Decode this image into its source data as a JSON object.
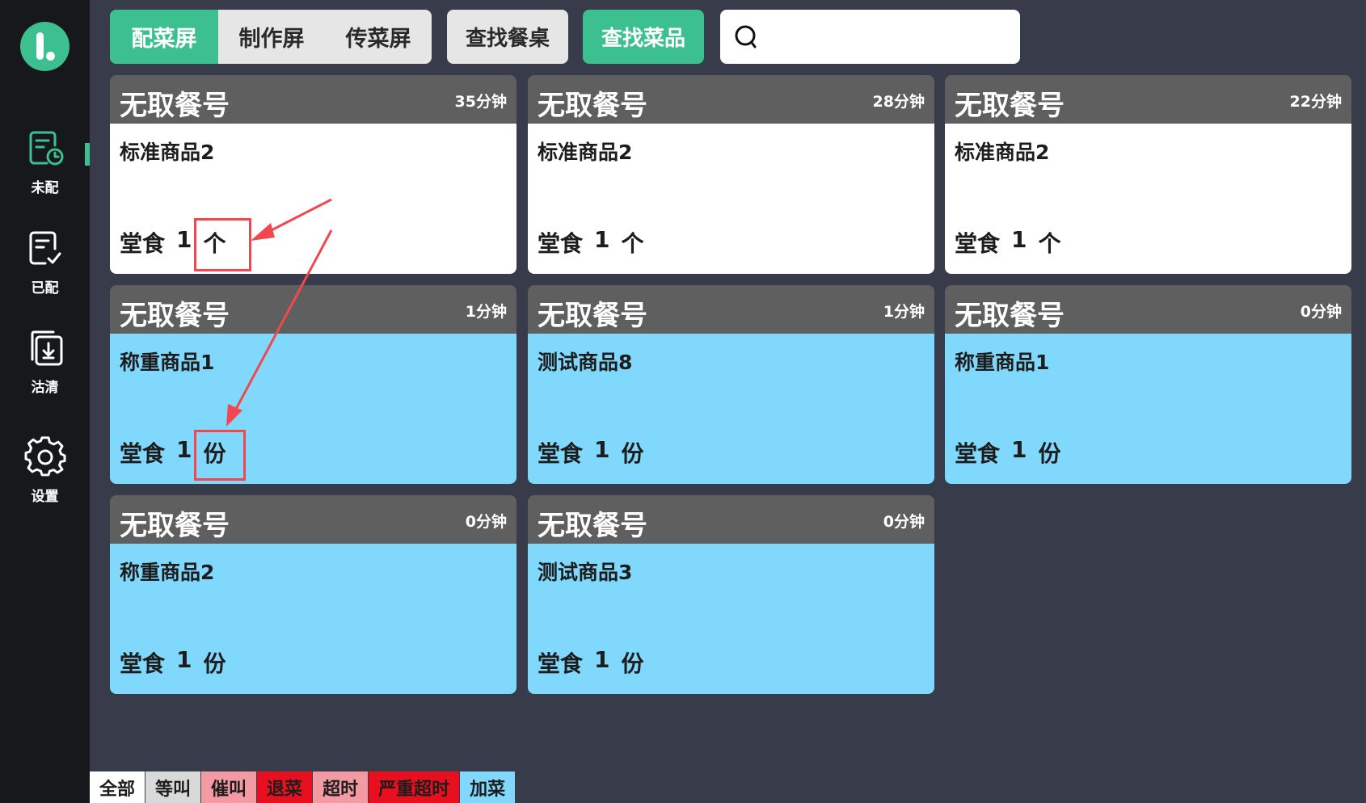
{
  "sidebar": {
    "logo": "app-logo",
    "items": [
      {
        "label": "未配",
        "icon": "pending-order-icon",
        "active": true
      },
      {
        "label": "已配",
        "icon": "done-order-icon",
        "active": false
      },
      {
        "label": "沽清",
        "icon": "sold-out-icon",
        "active": false
      },
      {
        "label": "设置",
        "icon": "gear-icon",
        "active": false
      }
    ]
  },
  "topbar": {
    "screens": [
      "配菜屏",
      "制作屏",
      "传菜屏"
    ],
    "active_screen": "配菜屏",
    "find_table": "查找餐桌",
    "find_dish": "查找菜品",
    "search": {
      "value": "",
      "placeholder": ""
    }
  },
  "cards": [
    {
      "order": "无取餐号",
      "time": "35分钟",
      "item": "标准商品2",
      "dine": "堂食",
      "count": "1",
      "unit": "个",
      "color": "#ffffff"
    },
    {
      "order": "无取餐号",
      "time": "28分钟",
      "item": "标准商品2",
      "dine": "堂食",
      "count": "1",
      "unit": "个",
      "color": "#ffffff"
    },
    {
      "order": "无取餐号",
      "time": "22分钟",
      "item": "标准商品2",
      "dine": "堂食",
      "count": "1",
      "unit": "个",
      "color": "#ffffff"
    },
    {
      "order": "无取餐号",
      "time": "1分钟",
      "item": "称重商品1",
      "dine": "堂食",
      "count": "1",
      "unit": "份",
      "color": "#80d8fc"
    },
    {
      "order": "无取餐号",
      "time": "1分钟",
      "item": "测试商品8",
      "dine": "堂食",
      "count": "1",
      "unit": "份",
      "color": "#80d8fc"
    },
    {
      "order": "无取餐号",
      "time": "0分钟",
      "item": "称重商品1",
      "dine": "堂食",
      "count": "1",
      "unit": "份",
      "color": "#80d8fc"
    },
    {
      "order": "无取餐号",
      "time": "0分钟",
      "item": "称重商品2",
      "dine": "堂食",
      "count": "1",
      "unit": "份",
      "color": "#80d8fc"
    },
    {
      "order": "无取餐号",
      "time": "0分钟",
      "item": "测试商品3",
      "dine": "堂食",
      "count": "1",
      "unit": "份",
      "color": "#80d8fc"
    }
  ],
  "legend": [
    {
      "label": "全部",
      "color": "#ffffff"
    },
    {
      "label": "等叫",
      "color": "#d9d9d9"
    },
    {
      "label": "催叫",
      "color": "#f39aa3"
    },
    {
      "label": "退菜",
      "color": "#e8101e"
    },
    {
      "label": "超时",
      "color": "#f39aa3"
    },
    {
      "label": "严重超时",
      "color": "#e8101e"
    },
    {
      "label": "加菜",
      "color": "#80d8fc"
    }
  ],
  "colors": {
    "accent": "#3cc08f",
    "background": "#383b4a",
    "sidebar": "#17181c",
    "card_header": "#5f5f5f",
    "annotation": "#f0484e"
  }
}
